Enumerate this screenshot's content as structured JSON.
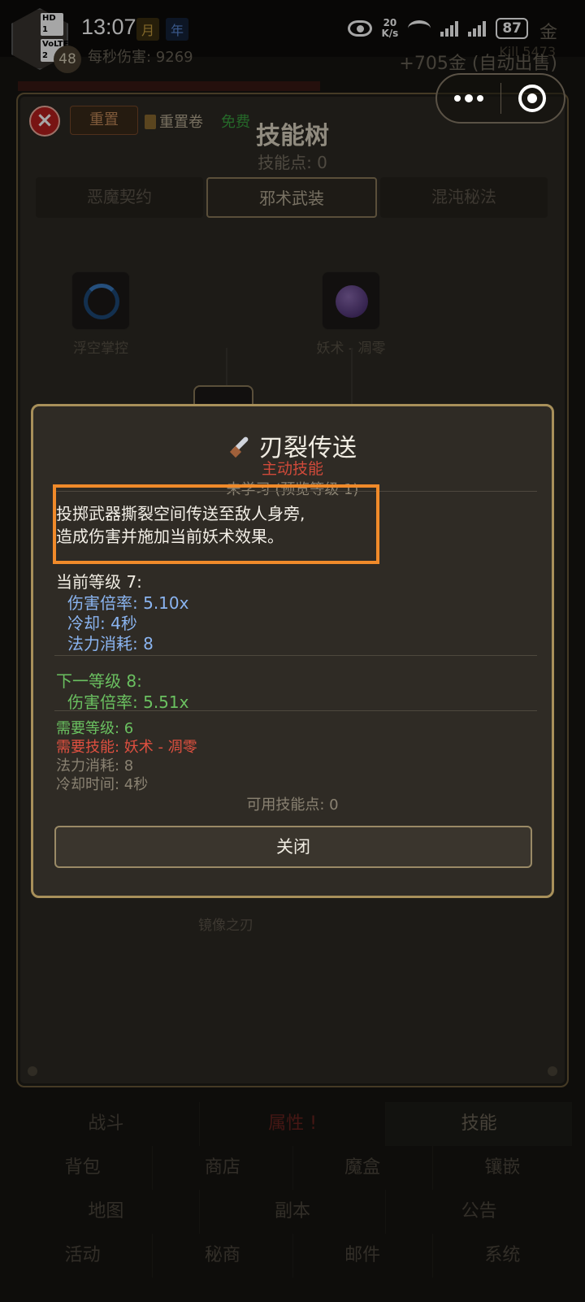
{
  "status_bar": {
    "time": "13:07",
    "badge_hd": "HD 1",
    "badge_volte": "VoLTE 2",
    "net_speed_value": "20",
    "net_speed_unit": "K/s",
    "battery": "87"
  },
  "background": {
    "level": "48",
    "tab_month": "月",
    "tab_year": "年",
    "dps_label": "每秒伤害: 9269",
    "gold_suffix": "金",
    "gold_auto_sell": "+705金 (自动出售)",
    "kill_count": "Kill 5473"
  },
  "panel": {
    "close_icon": "close-icon",
    "reset_label": "重置",
    "reset_scroll_label": "重置卷",
    "free_label": "免费",
    "title": "技能树",
    "skill_points": "技能点: 0",
    "tabs": [
      {
        "label": "恶魔契约"
      },
      {
        "label": "邪术武装"
      },
      {
        "label": "混沌秘法"
      }
    ],
    "nodes": [
      {
        "label": "浮空掌控",
        "icon": "vortex-icon"
      },
      {
        "label": "妖术 - 凋零",
        "icon": "orb-icon"
      },
      {
        "label": "镜像之刃",
        "icon": "mirror-icon"
      }
    ]
  },
  "bottom_nav": {
    "row1": [
      {
        "label": "战斗"
      },
      {
        "label": "属性 !"
      },
      {
        "label": "技能"
      }
    ],
    "row2": [
      {
        "label": "背包"
      },
      {
        "label": "商店"
      },
      {
        "label": "魔盒"
      },
      {
        "label": "镶嵌"
      }
    ],
    "row3": [
      {
        "label": "地图"
      },
      {
        "label": "副本"
      },
      {
        "label": "公告"
      }
    ],
    "row4": [
      {
        "label": "活动"
      },
      {
        "label": "秘商"
      },
      {
        "label": "邮件"
      },
      {
        "label": "系统"
      }
    ]
  },
  "dialog": {
    "icon": "dagger-icon",
    "title": "刃裂传送",
    "subtitle": "主动技能",
    "status": "未学习 (预览等级 1)",
    "description_line1": "投掷武器撕裂空间传送至敌人身旁,",
    "description_line2": "造成伤害并施加当前妖术效果。",
    "current_level_title": "当前等级 7:",
    "current_stats": [
      "伤害倍率: 5.10x",
      "冷却: 4秒",
      "法力消耗: 8"
    ],
    "next_level_title": "下一等级 8:",
    "next_stats": [
      "伤害倍率: 5.51x"
    ],
    "req_level": "需要等级: 6",
    "req_skill": "需要技能: 妖术 - 凋零",
    "mana_cost": "法力消耗: 8",
    "cooldown": "冷却时间: 4秒",
    "available_points": "可用技能点: 0",
    "close_label": "关闭",
    "highlight_color": "#f08a2a"
  }
}
